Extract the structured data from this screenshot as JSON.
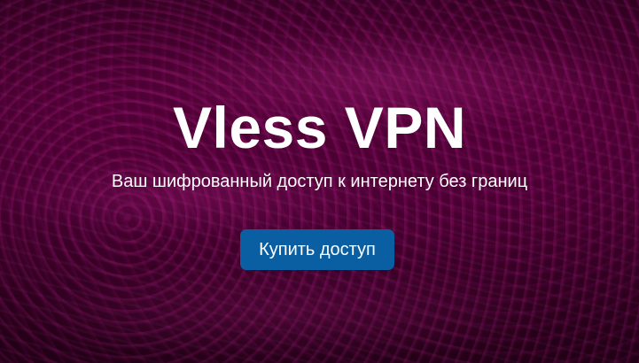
{
  "hero": {
    "title": "Vless VPN",
    "subtitle": "Ваш шифрованный доступ к интернету без границ",
    "cta_label": "Купить доступ"
  },
  "colors": {
    "background": "#4a0032",
    "button": "#0a5fa3",
    "text": "#ffffff"
  }
}
